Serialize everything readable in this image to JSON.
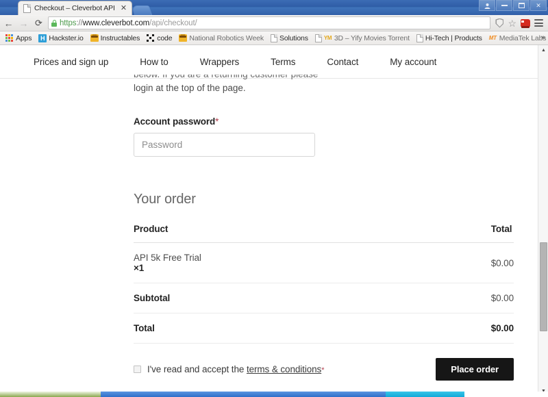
{
  "window": {
    "buttons": {
      "user_label": "☰",
      "minimize_label": "",
      "maximize_label": "",
      "close_label": "✕"
    }
  },
  "tab": {
    "title": "Checkout – Cleverbot API",
    "close_label": "✕",
    "favicon": "document-icon"
  },
  "toolbar": {
    "back_label": "←",
    "forward_label": "→",
    "reload_label": "⟳",
    "url": {
      "scheme": "https",
      "separator": "://",
      "host": "www.cleverbot.com",
      "path": "/api/checkout/"
    },
    "lock_icon": "lock-icon",
    "shield_icon": "shield-icon",
    "star_label": "☆",
    "extension_icon": "car-extension-icon",
    "menu_icon": "hamburger-menu-icon"
  },
  "bookmarks": {
    "apps_label": "Apps",
    "overflow_label": "»",
    "items": [
      {
        "label": "Hackster.io",
        "icon": "hackster-icon",
        "icon_text": "H",
        "faded": false
      },
      {
        "label": "Instructables",
        "icon": "robot-icon",
        "icon_text": "",
        "faded": false
      },
      {
        "label": "code",
        "icon": "code-icon",
        "icon_text": "",
        "faded": false
      },
      {
        "label": "National Robotics Week",
        "icon": "robot-icon",
        "icon_text": "",
        "faded": false
      },
      {
        "label": "Solutions",
        "icon": "document-icon",
        "icon_text": "",
        "faded": false
      },
      {
        "label": "3D – Yify Movies Torrent",
        "icon": "ym-icon",
        "icon_text": "YM",
        "faded": true
      },
      {
        "label": "Hi-Tech | Products",
        "icon": "document-icon",
        "icon_text": "",
        "faded": false
      },
      {
        "label": "MediaTek Labs | Dev Too",
        "icon": "mediatek-icon",
        "icon_text": "MT",
        "faded": true
      }
    ]
  },
  "site": {
    "nav": [
      {
        "label": "Prices and sign up"
      },
      {
        "label": "How to"
      },
      {
        "label": "Wrappers"
      },
      {
        "label": "Terms"
      },
      {
        "label": "Contact"
      },
      {
        "label": "My account"
      }
    ]
  },
  "checkout": {
    "intro_clipped": "below. If you are a returning customer please",
    "intro_visible": "login at the top of the page.",
    "password_label": "Account password",
    "required_marker": "*",
    "password_value": "",
    "password_placeholder": "Password",
    "order_heading": "Your order",
    "table": {
      "headers": [
        "Product",
        "Total"
      ],
      "rows": [
        {
          "product": "API 5k Free Trial",
          "qty": "×1",
          "total": "$0.00",
          "kind": "item"
        },
        {
          "product": "Subtotal",
          "qty": "",
          "total": "$0.00",
          "kind": "sum"
        },
        {
          "product": "Total",
          "qty": "",
          "total": "$0.00",
          "kind": "grand"
        }
      ]
    },
    "terms": {
      "checked": false,
      "text_before": "I've read and accept the",
      "link_label": "terms & conditions",
      "required_marker": "*"
    },
    "place_order_label": "Place order"
  },
  "scrollbar": {
    "up_label": "▲",
    "down_label": "▼"
  },
  "colors": {
    "accent_blue": "#2f5da6",
    "lock_green": "#5bb85b",
    "required_red": "#b03a4a",
    "button_black": "#161616"
  }
}
